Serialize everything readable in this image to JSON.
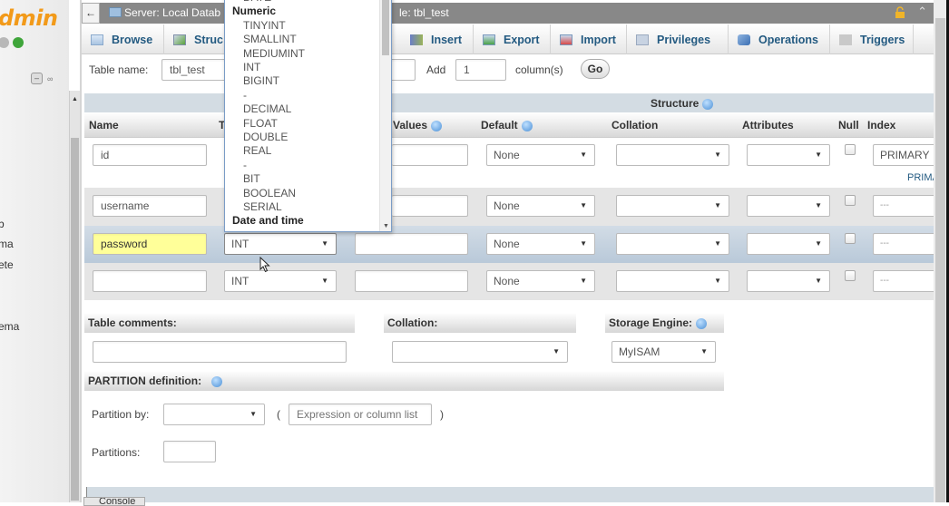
{
  "nav": {
    "logo_text": "dmin",
    "items": [
      "b",
      "ma",
      "ete",
      "ema"
    ]
  },
  "topbar": {
    "back_label": "←",
    "breadcrumb_server": "Server: Local Datab",
    "breadcrumb_table": "le: tbl_test"
  },
  "tabs": [
    {
      "label": "Browse",
      "icon": "browse-icon"
    },
    {
      "label": "Struc",
      "icon": "structure-icon"
    },
    {
      "label": "Insert",
      "icon": "insert-icon"
    },
    {
      "label": "Export",
      "icon": "export-icon"
    },
    {
      "label": "Import",
      "icon": "import-icon"
    },
    {
      "label": "Privileges",
      "icon": "privileges-icon"
    },
    {
      "label": "Operations",
      "icon": "operations-icon"
    },
    {
      "label": "Triggers",
      "icon": "triggers-icon"
    }
  ],
  "form": {
    "table_name_label": "Table name:",
    "table_name_value": "tbl_test",
    "add_label": "Add",
    "add_count": "1",
    "columns_label": "column(s)",
    "go_label": "Go"
  },
  "structure": {
    "title": "Structure",
    "headers": {
      "name": "Name",
      "type": "T",
      "values": "Values",
      "default": "Default",
      "collation": "Collation",
      "attributes": "Attributes",
      "null": "Null",
      "index": "Index"
    },
    "rows": [
      {
        "name": "id",
        "type": "",
        "values": "",
        "default": "None",
        "collation": "",
        "attributes": "",
        "null": false,
        "index": "PRIMARY",
        "index_link": "PRIMA"
      },
      {
        "name": "username",
        "type": "",
        "values": "",
        "default": "None",
        "collation": "",
        "attributes": "",
        "null": false,
        "index": "---"
      },
      {
        "name": "password",
        "type": "INT",
        "values": "",
        "default": "None",
        "collation": "",
        "attributes": "",
        "null": false,
        "index": "---"
      },
      {
        "name": "",
        "type": "INT",
        "values": "",
        "default": "None",
        "collation": "",
        "attributes": "",
        "null": false,
        "index": "---"
      }
    ]
  },
  "type_dropdown": {
    "items": [
      {
        "kind": "opt",
        "label": "DATE"
      },
      {
        "kind": "grp",
        "label": "Numeric"
      },
      {
        "kind": "opt",
        "label": "TINYINT"
      },
      {
        "kind": "opt",
        "label": "SMALLINT"
      },
      {
        "kind": "opt",
        "label": "MEDIUMINT"
      },
      {
        "kind": "opt",
        "label": "INT"
      },
      {
        "kind": "opt",
        "label": "BIGINT"
      },
      {
        "kind": "opt",
        "label": "-"
      },
      {
        "kind": "opt",
        "label": "DECIMAL"
      },
      {
        "kind": "opt",
        "label": "FLOAT"
      },
      {
        "kind": "opt",
        "label": "DOUBLE"
      },
      {
        "kind": "opt",
        "label": "REAL"
      },
      {
        "kind": "opt",
        "label": "-"
      },
      {
        "kind": "opt",
        "label": "BIT"
      },
      {
        "kind": "opt",
        "label": "BOOLEAN"
      },
      {
        "kind": "opt",
        "label": "SERIAL"
      },
      {
        "kind": "grp",
        "label": "Date and time"
      }
    ]
  },
  "table_options": {
    "comments_label": "Table comments:",
    "comments_value": "",
    "collation_label": "Collation:",
    "collation_value": "",
    "engine_label": "Storage Engine:",
    "engine_value": "MyISAM"
  },
  "partition": {
    "title": "PARTITION definition:",
    "by_label": "Partition by:",
    "by_value": "",
    "open_paren": "(",
    "expression_placeholder": "Expression or column list",
    "close_paren": ")",
    "partitions_label": "Partitions:",
    "partitions_value": ""
  },
  "console": {
    "label": "Console"
  },
  "colors": {
    "accent": "#235a81",
    "logo": "#f29a1a",
    "highlight_input": "#ffff99",
    "selected_row": "#c8d4e0"
  }
}
